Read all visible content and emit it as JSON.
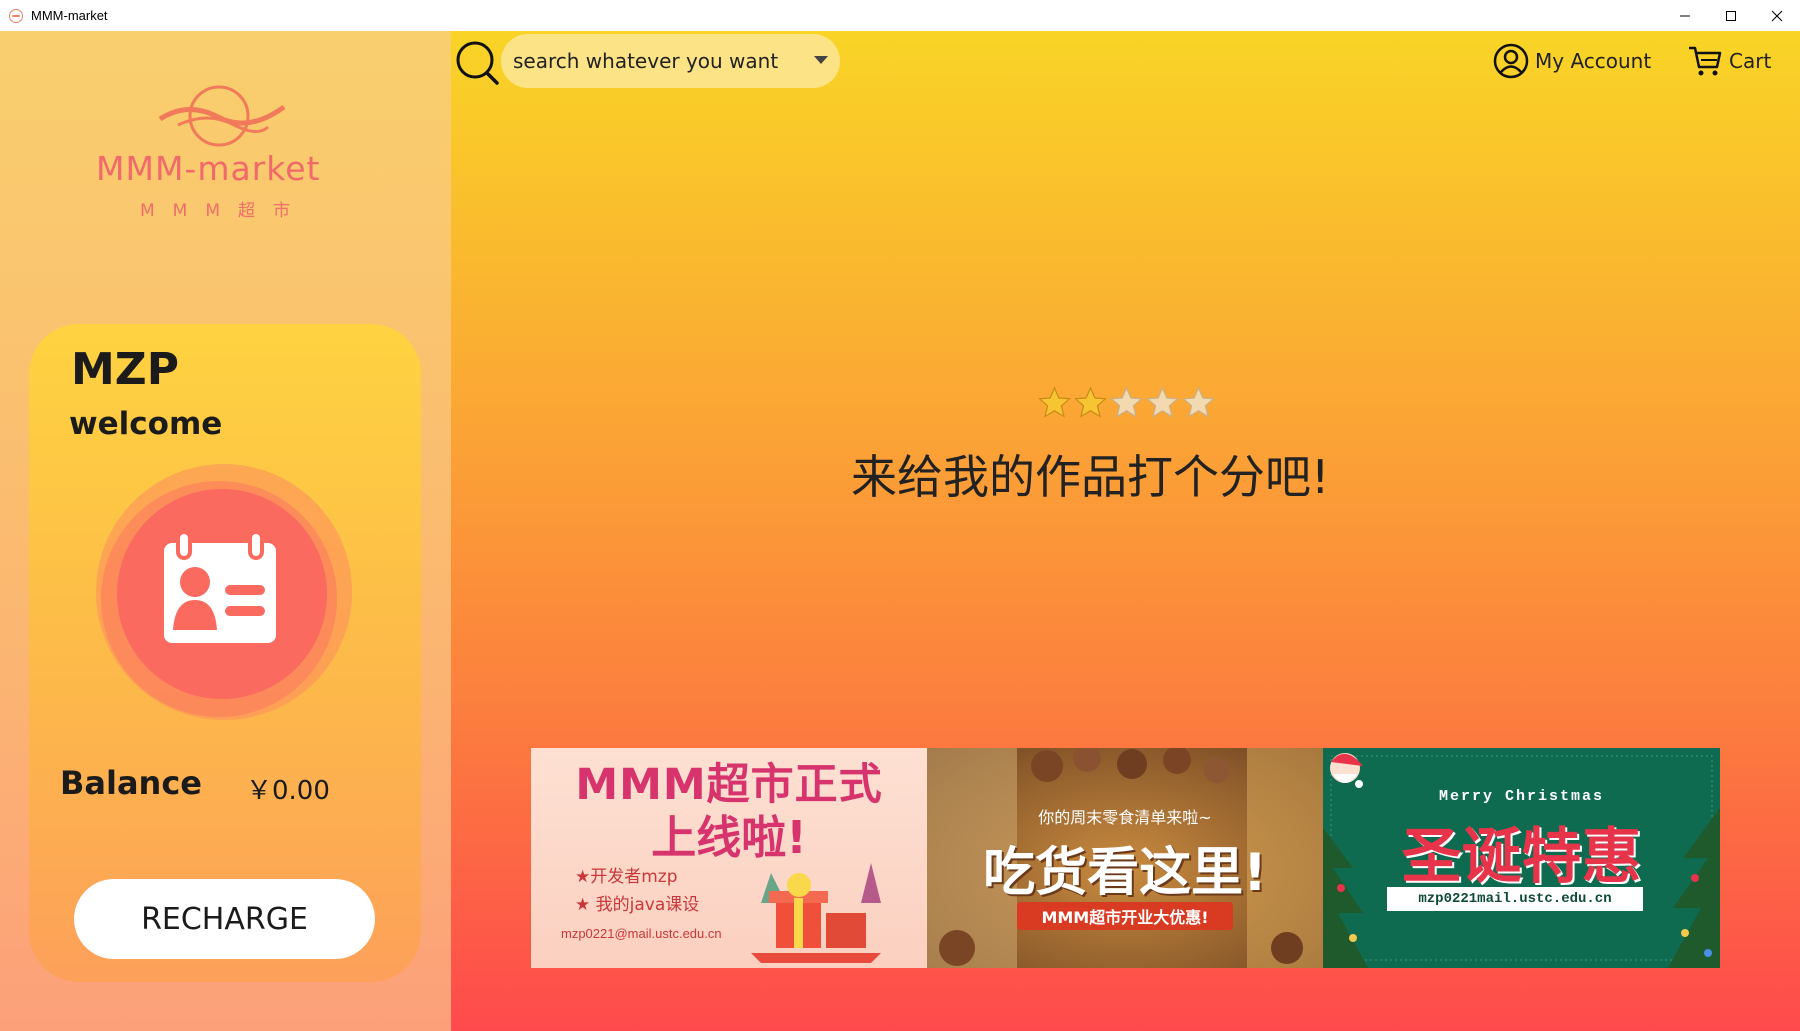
{
  "window": {
    "title": "MMM-market",
    "controls": {
      "minimize_icon": "minimize-icon",
      "maximize_icon": "maximize-icon",
      "close_icon": "close-icon"
    }
  },
  "sidebar": {
    "logo": {
      "text": "MMM-market",
      "subtitle": "MMM超市",
      "color": "#f06a6a"
    },
    "user": {
      "name": "MZP",
      "greeting": "welcome",
      "avatar_icon": "id-card-icon",
      "balance_label": "Balance",
      "balance_value": "￥0.00",
      "recharge_label": "RECHARGE"
    }
  },
  "header": {
    "search": {
      "placeholder": "search whatever you want",
      "icon": "search-icon"
    },
    "account_label": "My Account",
    "cart_label": "Cart"
  },
  "main": {
    "rating": {
      "stars_total": 5,
      "stars_filled": 2
    },
    "rating_prompt": "来给我的作品打个分吧!",
    "banners": [
      {
        "title_line1": "MMM超市正式",
        "title_line2": "上线啦!",
        "bullet1": "★开发者mzp",
        "bullet2": "★ 我的java课设",
        "email": "mzp0221@mail.ustc.edu.cn"
      },
      {
        "subtitle": "你的周末零食清单来啦~",
        "title": "吃货看这里!",
        "tag": "MMM超市开业大优惠!"
      },
      {
        "greeting": "Merry Christmas",
        "title": "圣诞特惠",
        "email": "mzp0221mail.ustc.edu.cn"
      }
    ]
  },
  "colors": {
    "sidebar_top": "#f9cf6e",
    "main_top": "#f9d426",
    "main_bottom": "#fe4a4c",
    "avatar": "#fa6a5e"
  }
}
